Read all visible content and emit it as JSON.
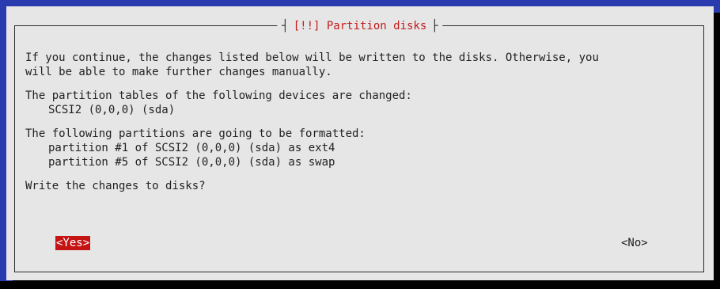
{
  "dialog": {
    "title": "[!!] Partition disks",
    "title_left_bracket": "┤",
    "title_right_bracket": "├",
    "lines": [
      "If you continue, the changes listed below will be written to the disks. Otherwise, you",
      "will be able to make further changes manually.",
      "The partition tables of the following devices are changed:",
      "SCSI2 (0,0,0) (sda)",
      "The following partitions are going to be formatted:",
      "partition #1 of SCSI2 (0,0,0) (sda) as ext4",
      "partition #5 of SCSI2 (0,0,0) (sda) as swap",
      "Write the changes to disks?"
    ],
    "buttons": {
      "yes": "<Yes>",
      "no": "<No>"
    }
  },
  "colors": {
    "background": "#2a3bb0",
    "dialog": "#e6e6e6",
    "title": "#c31a1a",
    "selected_button": "#c41414",
    "text": "#222222"
  }
}
